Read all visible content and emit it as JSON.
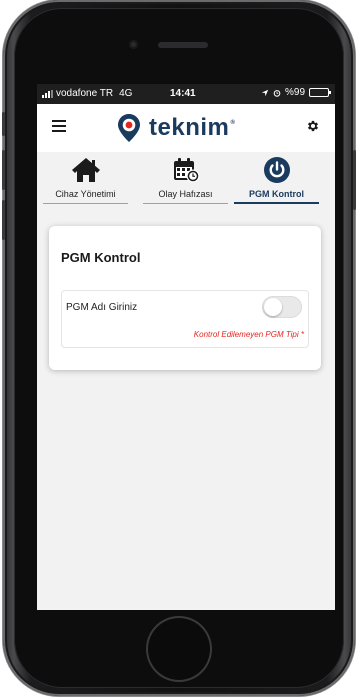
{
  "statusbar": {
    "carrier": "vodafone TR",
    "network": "4G",
    "time": "14:41",
    "battery": "%99"
  },
  "appbar": {
    "menu_icon": "menu-icon",
    "logo_text": "teknim",
    "logo_mark": "®",
    "settings_icon": "gear-icon"
  },
  "tabs": [
    {
      "label": "Cihaz Yönetimi",
      "icon": "home-icon",
      "active": false
    },
    {
      "label": "Olay Hafızası",
      "icon": "calendar-clock-icon",
      "active": false
    },
    {
      "label": "PGM Kontrol",
      "icon": "power-icon",
      "active": true
    }
  ],
  "card": {
    "title": "PGM Kontrol",
    "rows": [
      {
        "label": "PGM Adı Giriniz",
        "toggle_on": false,
        "error": "Kontrol Edilemeyen PGM Tipi *"
      }
    ]
  },
  "colors": {
    "brand": "#1a3a5e",
    "error": "#e5261f",
    "background": "#f2f2f2"
  }
}
